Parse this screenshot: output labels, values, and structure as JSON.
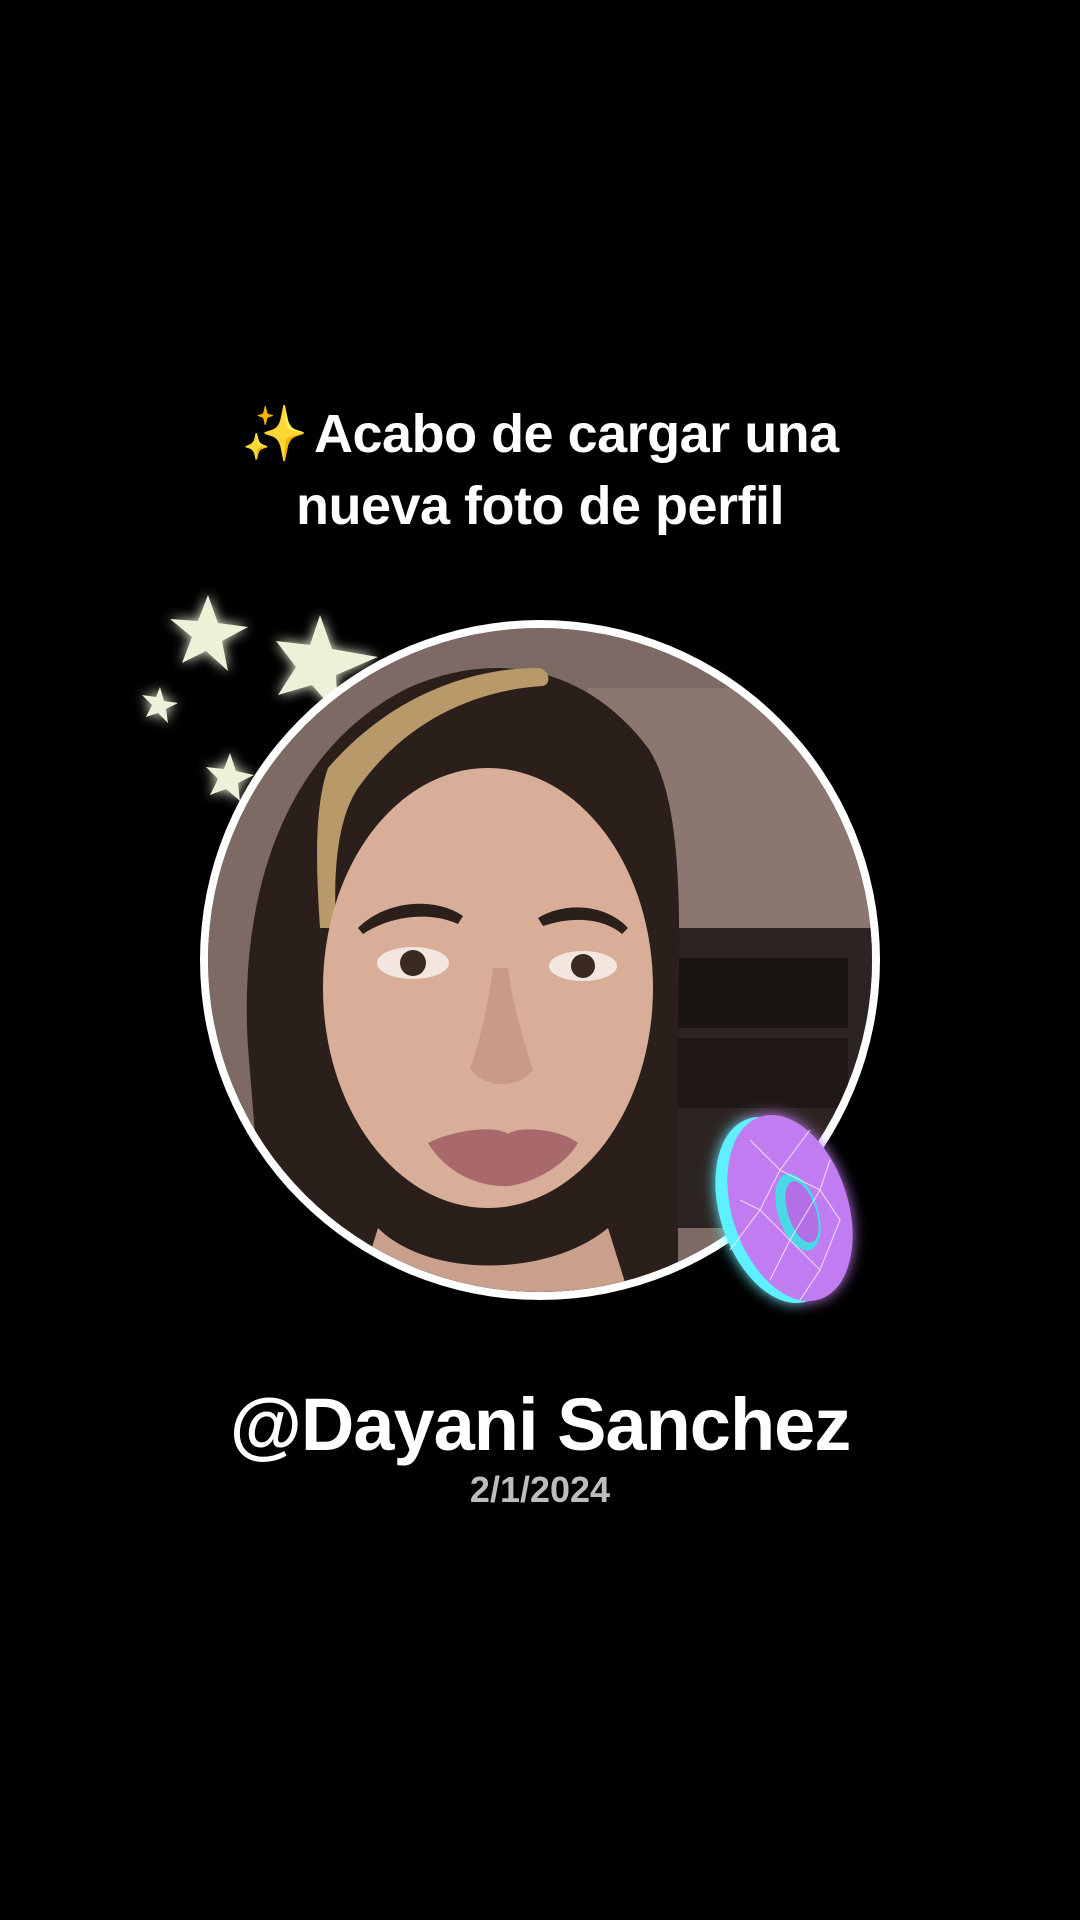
{
  "header": {
    "sparkle_emoji": "✨",
    "line1": "Acabo de cargar una",
    "line2": "nueva foto de perfil"
  },
  "profile": {
    "username": "@Dayani Sanchez",
    "date": "2/1/2024"
  },
  "decorations": {
    "stars_icon": "sparkle-stars-icon",
    "donut_icon": "wireframe-donut-icon",
    "donut_color": "#c07cf0",
    "donut_accent": "#5ff0ff",
    "star_color": "#eef0d8"
  },
  "colors": {
    "background": "#000000",
    "text": "#ffffff",
    "date_text": "#bdbdbd",
    "avatar_border": "#ffffff"
  }
}
